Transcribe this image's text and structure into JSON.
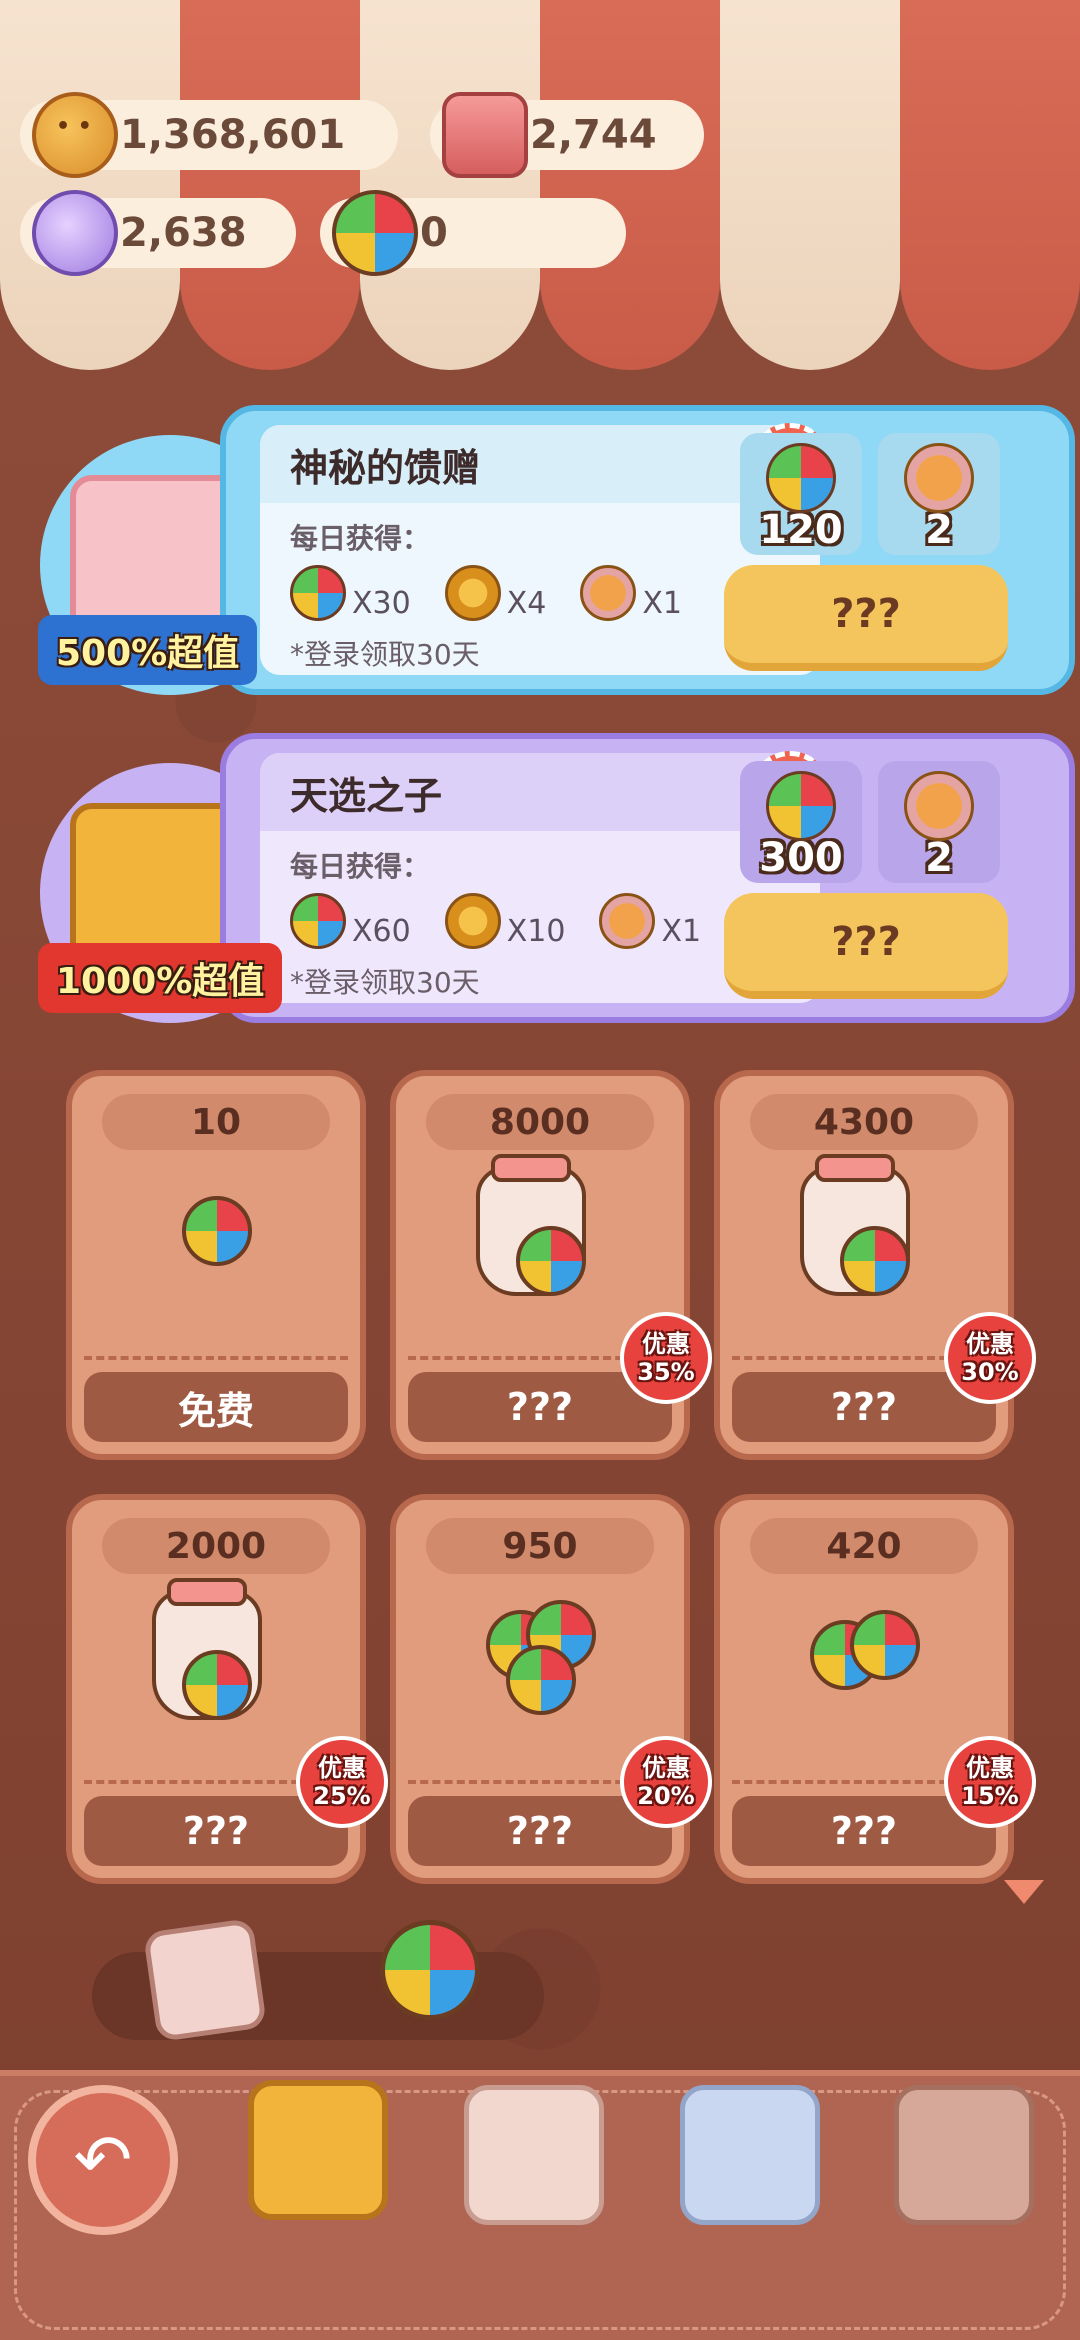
{
  "currencies": [
    {
      "name": "cookie-coin",
      "value": "1,368,601"
    },
    {
      "name": "candle",
      "value": "2,744"
    },
    {
      "name": "candy",
      "value": "2,638"
    },
    {
      "name": "windmill-token",
      "value": "0"
    }
  ],
  "premium": [
    {
      "title": "神秘的馈赠",
      "daily_label": "每日获得：",
      "rewards": [
        "X30",
        "X4",
        "X1"
      ],
      "note": "*登录领取30天",
      "slot1": "120",
      "slot2": "2",
      "button": "???",
      "ribbon": "500%超值"
    },
    {
      "title": "天选之子",
      "daily_label": "每日获得：",
      "rewards": [
        "X60",
        "X10",
        "X1"
      ],
      "note": "*登录领取30天",
      "slot1": "300",
      "slot2": "2",
      "button": "???",
      "ribbon": "1000%超值"
    }
  ],
  "shop": [
    {
      "price": "10",
      "action": "免费"
    },
    {
      "price": "8000",
      "action": "???",
      "discount_top": "优惠",
      "discount_pct": "35%"
    },
    {
      "price": "4300",
      "action": "???",
      "discount_top": "优惠",
      "discount_pct": "30%"
    },
    {
      "price": "2000",
      "action": "???",
      "discount_top": "优惠",
      "discount_pct": "25%"
    },
    {
      "price": "950",
      "action": "???",
      "discount_top": "优惠",
      "discount_pct": "20%"
    },
    {
      "price": "420",
      "action": "???",
      "discount_top": "优惠",
      "discount_pct": "15%"
    }
  ],
  "colors": {
    "accent": "#f4c55c",
    "badge": "#e8423f",
    "awning_red": "#d96c57",
    "awning_cream": "#f6e3cf"
  }
}
